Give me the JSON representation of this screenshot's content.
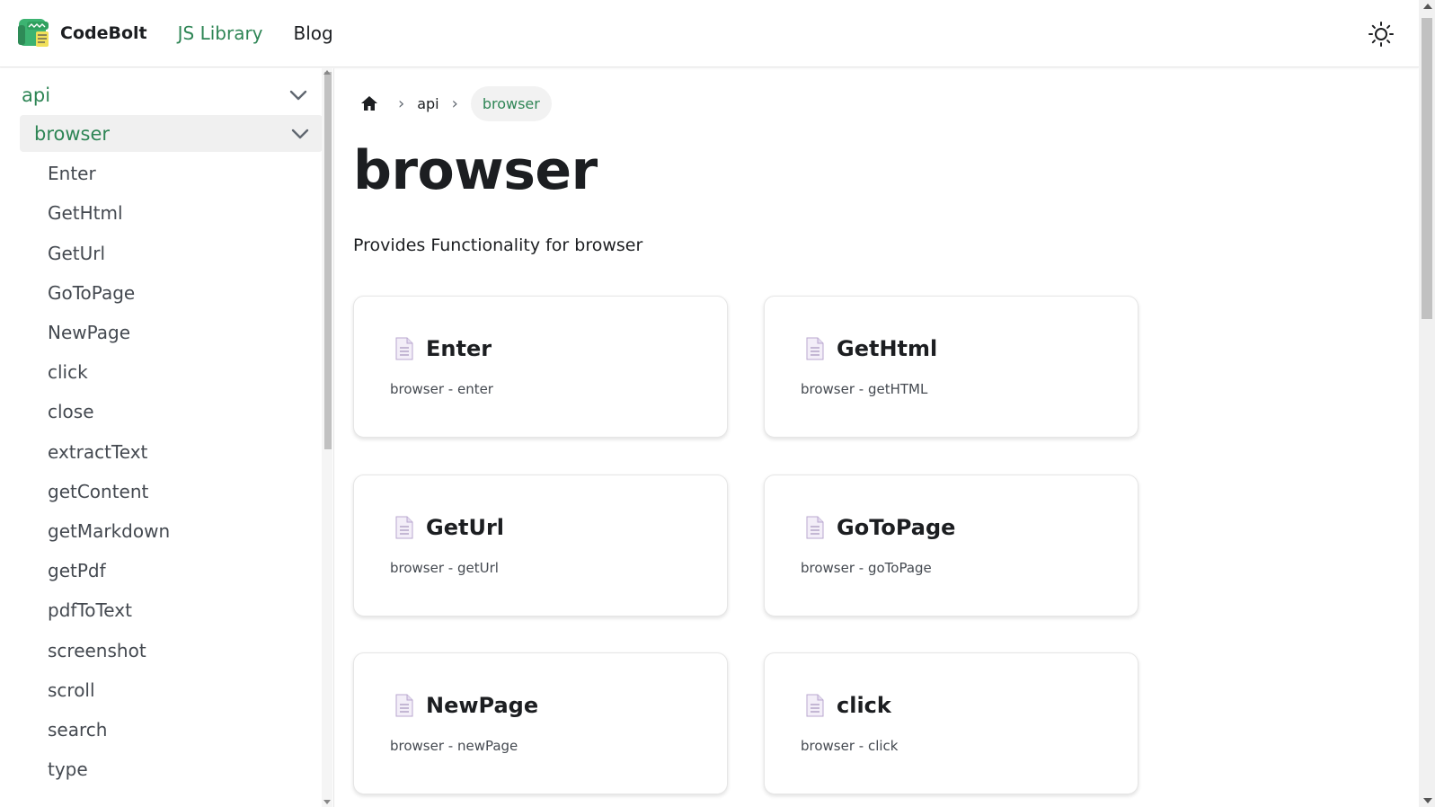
{
  "navbar": {
    "brand": "CodeBolt",
    "links": [
      {
        "label": "JS Library",
        "active": true
      },
      {
        "label": "Blog",
        "active": false
      }
    ],
    "theme_toggle_icon": "sun-icon"
  },
  "sidebar": {
    "categories": [
      {
        "label": "api",
        "expanded": true
      },
      {
        "label": "browser",
        "expanded": true,
        "active": true
      }
    ],
    "items": [
      "Enter",
      "GetHtml",
      "GetUrl",
      "GoToPage",
      "NewPage",
      "click",
      "close",
      "extractText",
      "getContent",
      "getMarkdown",
      "getPdf",
      "pdfToText",
      "screenshot",
      "scroll",
      "search",
      "type"
    ]
  },
  "breadcrumb": {
    "home_icon": "home-icon",
    "items": [
      "api",
      "browser"
    ]
  },
  "page": {
    "title": "browser",
    "description": "Provides Functionality for browser"
  },
  "cards": [
    {
      "title": "Enter",
      "description": "browser - enter"
    },
    {
      "title": "GetHtml",
      "description": "browser - getHTML"
    },
    {
      "title": "GetUrl",
      "description": "browser - getUrl"
    },
    {
      "title": "GoToPage",
      "description": "browser - goToPage"
    },
    {
      "title": "NewPage",
      "description": "browser - newPage"
    },
    {
      "title": "click",
      "description": "browser - click"
    }
  ],
  "colors": {
    "accent": "#2e8555",
    "text": "#1c1e21",
    "muted": "#444950",
    "active_bg": "#f0f0f0"
  }
}
